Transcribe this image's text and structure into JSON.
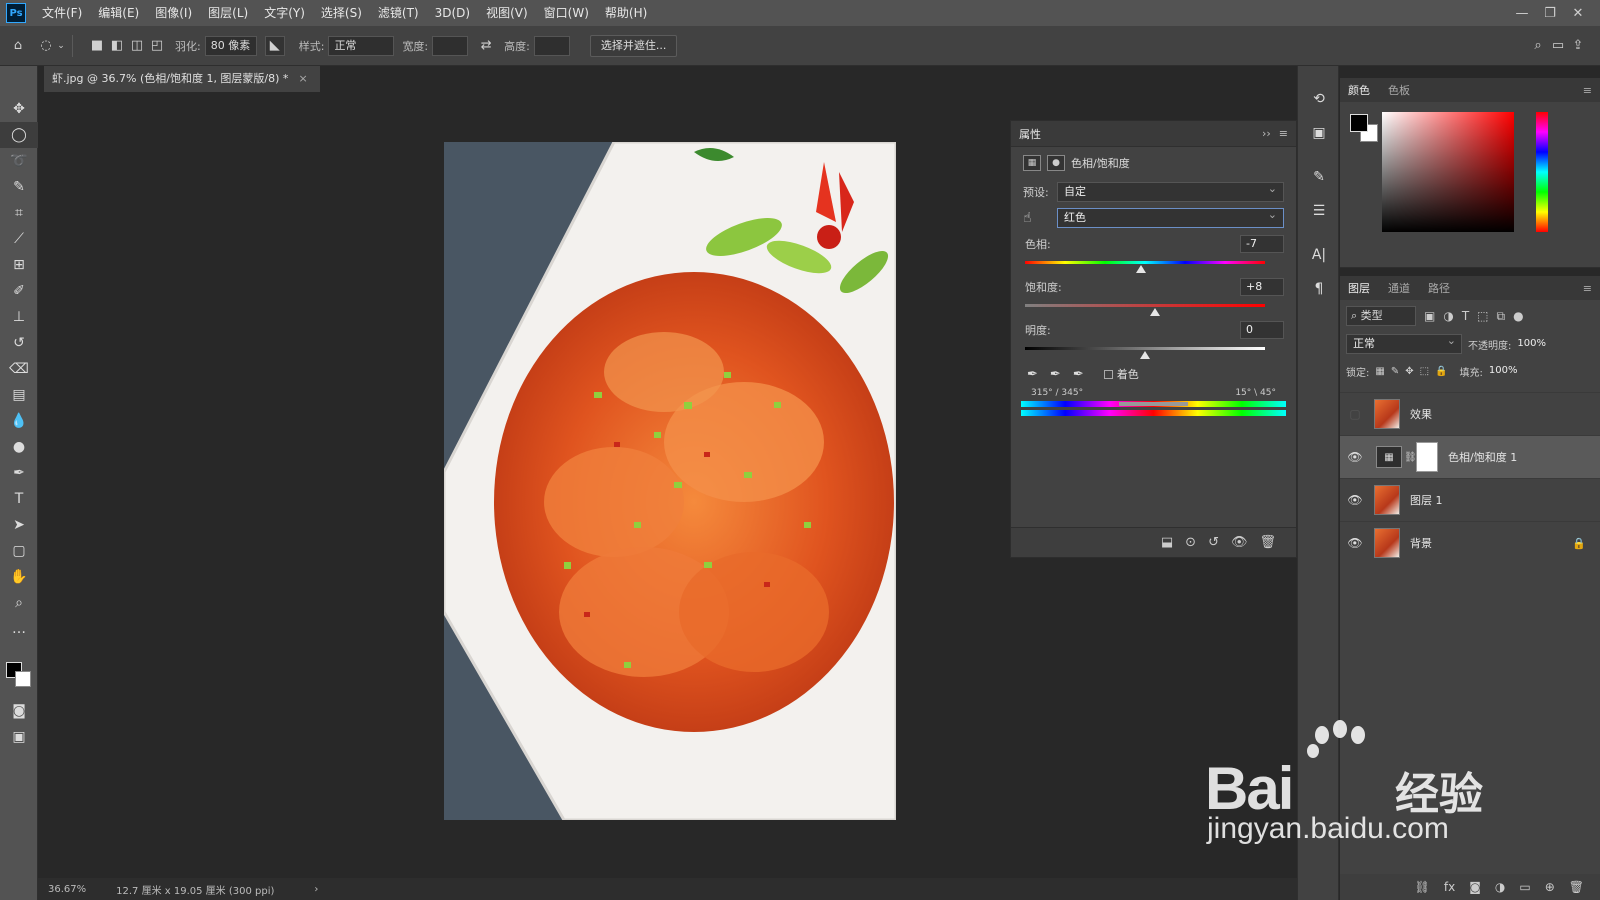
{
  "app": {
    "logo": "Ps",
    "menu": [
      "文件(F)",
      "编辑(E)",
      "图像(I)",
      "图层(L)",
      "文字(Y)",
      "选择(S)",
      "滤镜(T)",
      "3D(D)",
      "视图(V)",
      "窗口(W)",
      "帮助(H)"
    ]
  },
  "options": {
    "feather_label": "羽化:",
    "feather_value": "80 像素",
    "style_label": "样式:",
    "style_value": "正常",
    "width_label": "宽度:",
    "height_label": "高度:",
    "select_mask_button": "选择并遮住..."
  },
  "document": {
    "tab_title": "虾.jpg @ 36.7% (色相/饱和度 1, 图层蒙版/8) *",
    "close_glyph": "×"
  },
  "status": {
    "zoom": "36.67%",
    "doc_size": "12.7 厘米 x 19.05 厘米 (300 ppi)",
    "arrow": "›"
  },
  "properties": {
    "title": "属性",
    "adjustment_name": "色相/饱和度",
    "preset_label": "预设:",
    "preset_value": "自定",
    "channel_value": "红色",
    "hue_label": "色相:",
    "hue_value": "-7",
    "saturation_label": "饱和度:",
    "saturation_value": "+8",
    "lightness_label": "明度:",
    "lightness_value": "0",
    "colorize_label": "着色",
    "range_left": "315° / 345°",
    "range_right": "15° \\ 45°"
  },
  "color_panel": {
    "tabs": [
      "颜色",
      "色板"
    ]
  },
  "layers_panel": {
    "tabs": [
      "图层",
      "通道",
      "路径"
    ],
    "filter_label": "类型",
    "blend_mode": "正常",
    "opacity_label": "不透明度:",
    "opacity_value": "100%",
    "lock_label": "锁定:",
    "fill_label": "填充:",
    "fill_value": "100%",
    "layers": [
      {
        "name": "效果",
        "visible": false
      },
      {
        "name": "色相/饱和度 1",
        "visible": true,
        "selected": true
      },
      {
        "name": "图层 1",
        "visible": true
      },
      {
        "name": "背景",
        "visible": true,
        "locked": true
      }
    ]
  },
  "watermark": {
    "brand": "Bai",
    "cn": "经验",
    "url": "jingyan.baidu.com"
  }
}
